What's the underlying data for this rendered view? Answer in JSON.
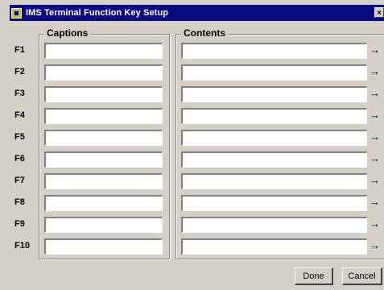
{
  "window": {
    "title": "IMS Terminal Function Key Setup",
    "close_glyph": "×",
    "icon": "app-icon"
  },
  "groups": {
    "captions_label": "Captions",
    "contents_label": "Contents"
  },
  "rows": [
    {
      "key": "F1",
      "caption": "",
      "content": "",
      "arrow": "→"
    },
    {
      "key": "F2",
      "caption": "",
      "content": "",
      "arrow": "→"
    },
    {
      "key": "F3",
      "caption": "",
      "content": "",
      "arrow": "→"
    },
    {
      "key": "F4",
      "caption": "",
      "content": "",
      "arrow": "→"
    },
    {
      "key": "F5",
      "caption": "",
      "content": "",
      "arrow": "→"
    },
    {
      "key": "F6",
      "caption": "",
      "content": "",
      "arrow": "→"
    },
    {
      "key": "F7",
      "caption": "",
      "content": "",
      "arrow": "→"
    },
    {
      "key": "F8",
      "caption": "",
      "content": "",
      "arrow": "→"
    },
    {
      "key": "F9",
      "caption": "",
      "content": "",
      "arrow": "→"
    },
    {
      "key": "F10",
      "caption": "",
      "content": "",
      "arrow": "→"
    }
  ],
  "buttons": {
    "done_label": "Done",
    "cancel_label": "Cancel"
  },
  "colors": {
    "titlebar": "#0a0a80",
    "dialog_face": "#d4d0c8",
    "field_background": "#ffffff"
  }
}
